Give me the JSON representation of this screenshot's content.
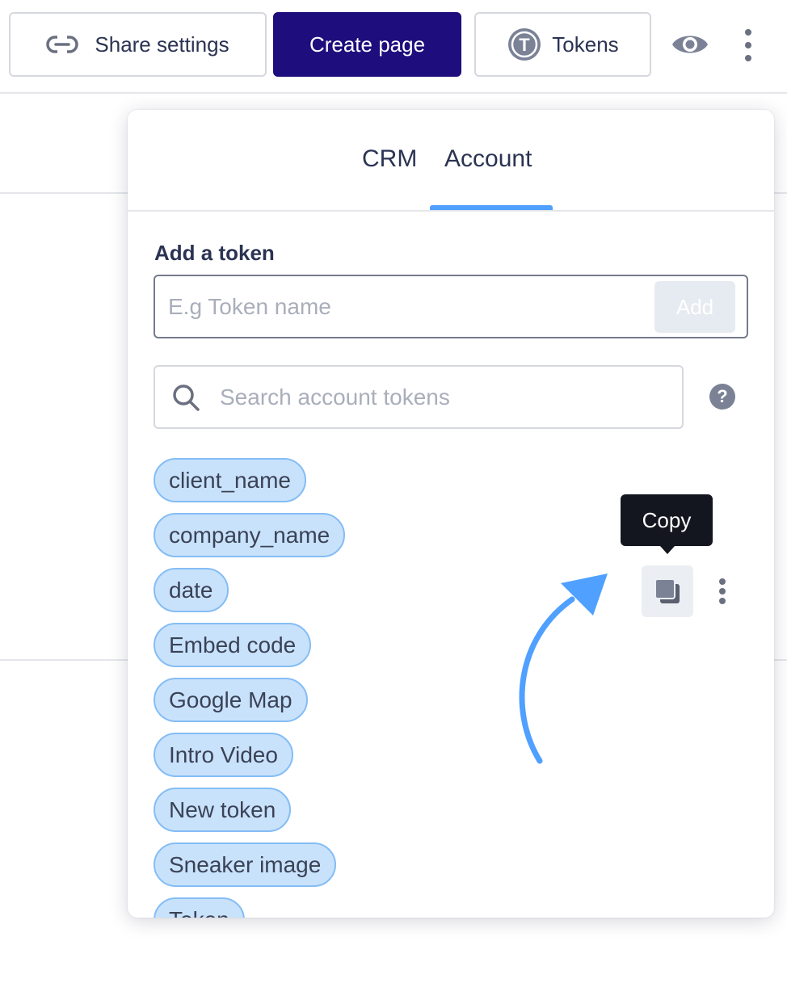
{
  "toolbar": {
    "share_label": "Share settings",
    "create_label": "Create page",
    "tokens_label": "Tokens",
    "tokens_badge": "T",
    "create_color": "#1e0d7c"
  },
  "panel": {
    "tabs": [
      {
        "label": "CRM",
        "active": false
      },
      {
        "label": "Account",
        "active": true
      }
    ],
    "add_token": {
      "label": "Add a token",
      "placeholder": "E.g Token name",
      "button_label": "Add"
    },
    "search": {
      "placeholder": "Search account tokens",
      "help_label": "?"
    },
    "tokens": [
      "client_name",
      "company_name",
      "date",
      "Embed code",
      "Google Map",
      "Intro Video",
      "New token",
      "Sneaker image",
      "Token"
    ],
    "tooltip": "Copy",
    "accent_color": "#4fa0ff",
    "chip_color": "#c9e2fb"
  },
  "icons": [
    "link-icon",
    "token-t-icon",
    "eye-icon",
    "more-vertical-icon",
    "search-icon",
    "help-icon",
    "copy-icon"
  ]
}
